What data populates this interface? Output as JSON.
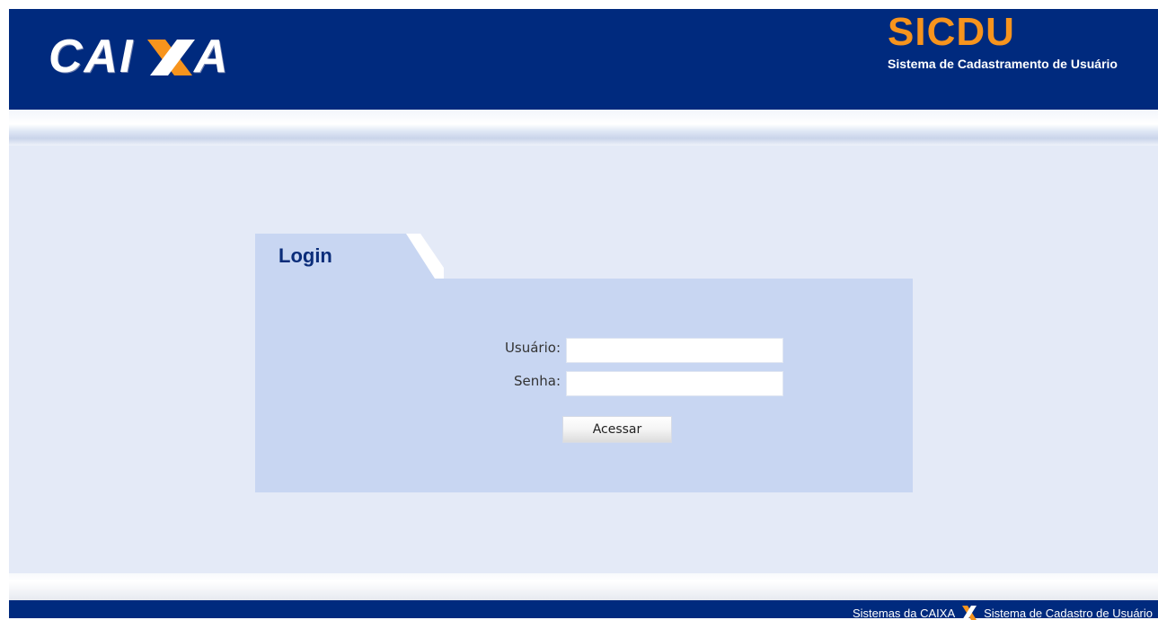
{
  "header": {
    "brand_logo_text": "CAIXA",
    "system_acronym": "SICDU",
    "system_name": "Sistema de Cadastramento de Usuário"
  },
  "login": {
    "title": "Login",
    "username_label": "Usuário:",
    "username_value": "",
    "password_label": "Senha:",
    "password_value": "",
    "submit_label": "Acessar"
  },
  "footer": {
    "left_text": "Sistemas da CAIXA",
    "right_text": "Sistema de Cadastro de Usuário"
  },
  "colors": {
    "brand_blue": "#002a7e",
    "accent_orange": "#f7941d",
    "panel_blue": "#c8d6f2",
    "background": "#e4eaf7"
  },
  "icons": {
    "footer_separator": "caixa-x-icon"
  }
}
